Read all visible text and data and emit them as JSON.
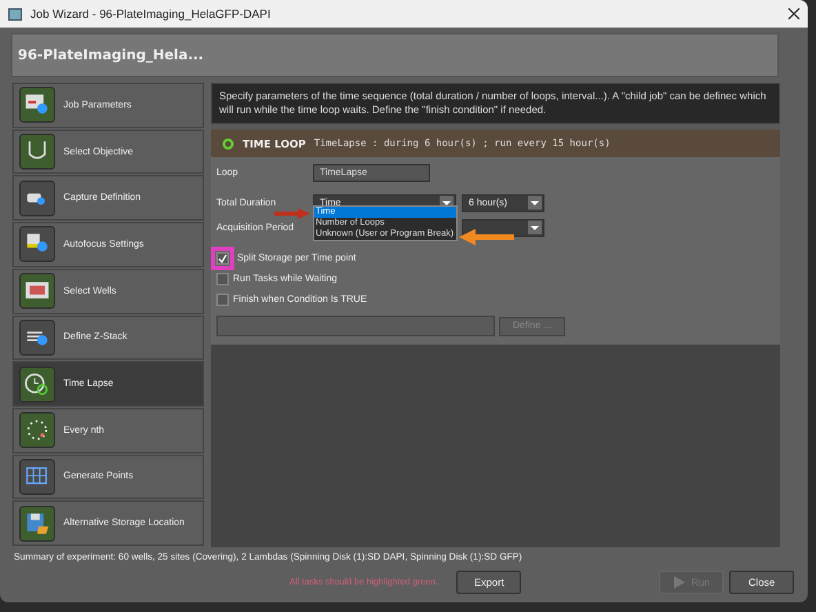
{
  "window": {
    "title": "Job Wizard - 96-PlateImaging_HelaGFP-DAPI"
  },
  "header": {
    "title": "96-PlateImaging_Hela..."
  },
  "sidebar": {
    "items": [
      {
        "label": "Job Parameters",
        "selected": false,
        "color": "#3f5e2f"
      },
      {
        "label": "Select Objective",
        "selected": false,
        "color": "#3f5e2f"
      },
      {
        "label": "Capture Definition",
        "selected": false,
        "color": "#4a4a4a"
      },
      {
        "label": "Autofocus Settings",
        "selected": false,
        "color": "#4a4a4a"
      },
      {
        "label": "Select Wells",
        "selected": false,
        "color": "#3f5e2f"
      },
      {
        "label": "Define Z-Stack",
        "selected": false,
        "color": "#4a4a4a"
      },
      {
        "label": "Time Lapse",
        "selected": true,
        "color": "#3f5e2f"
      },
      {
        "label": "Every nth",
        "selected": false,
        "color": "#3f5e2f"
      },
      {
        "label": "Generate Points",
        "selected": false,
        "color": "#4a4a4a"
      },
      {
        "label": "Alternative Storage Location",
        "selected": false,
        "color": "#3f5e2f"
      }
    ]
  },
  "description": "Specify parameters of the time sequence (total duration / number of loops, interval...). A \"child job\" can be definec which will run while the time loop waits. Define the \"finish condition\" if needed.",
  "loop_header": {
    "title": "TIME LOOP",
    "summary": "TimeLapse : during 6 hour(s) ; run every 15 hour(s)"
  },
  "form": {
    "loop_label": "Loop",
    "loop_value": "TimeLapse",
    "total_duration_label": "Total Duration",
    "total_duration_value": "Time",
    "duration_unit": "6 hour(s)",
    "acquisition_period_label": "Acquisition Period",
    "dropdown_options": [
      {
        "label": "Time",
        "selected": true
      },
      {
        "label": "Number of Loops",
        "selected": false
      },
      {
        "label": "Unknown (User or Program Break)",
        "selected": false
      }
    ],
    "checkboxes": [
      {
        "label": "Split Storage per Time point",
        "checked": true,
        "highlighted": true
      },
      {
        "label": "Run Tasks while Waiting",
        "checked": false,
        "highlighted": false
      },
      {
        "label": "Finish when Condition Is TRUE",
        "checked": false,
        "highlighted": false
      }
    ],
    "define_button": {
      "label": "Define ...",
      "disabled": true
    }
  },
  "summary": "Summary of experiment: 60 wells, 25 sites (Covering), 2 Lambdas (Spinning Disk (1):SD DAPI, Spinning Disk (1):SD GFP)",
  "warning": "All tasks should be highlighted green.",
  "buttons": [
    {
      "label": "Export",
      "disabled": false
    },
    {
      "label": "Run",
      "disabled": true
    },
    {
      "label": "Close",
      "disabled": false
    }
  ]
}
